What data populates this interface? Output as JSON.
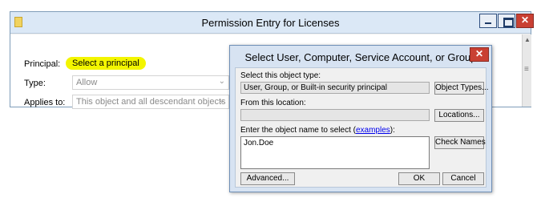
{
  "back_window": {
    "title": "Permission Entry for Licenses",
    "principal_label": "Principal:",
    "principal_link": "Select a principal",
    "type_label": "Type:",
    "type_value": "Allow",
    "applies_label": "Applies to:",
    "applies_value": "This object and all descendant objects"
  },
  "dialog": {
    "title": "Select User, Computer, Service Account, or Group",
    "object_type_label": "Select this object type:",
    "object_type_value": "User, Group, or Built-in security principal",
    "object_types_button": "Object Types...",
    "location_label": "From this location:",
    "location_value": "",
    "locations_button": "Locations...",
    "enter_name_label_prefix": "Enter the object name to select (",
    "examples_link": "examples",
    "enter_name_label_suffix": "):",
    "object_name_value": "Jon.Doe",
    "check_names_button": "Check Names",
    "advanced_button": "Advanced...",
    "ok_button": "OK",
    "cancel_button": "Cancel"
  },
  "colors": {
    "highlight": "#f3f500",
    "close_red": "#c94033",
    "dialog_frame": "#d7e3f2"
  }
}
